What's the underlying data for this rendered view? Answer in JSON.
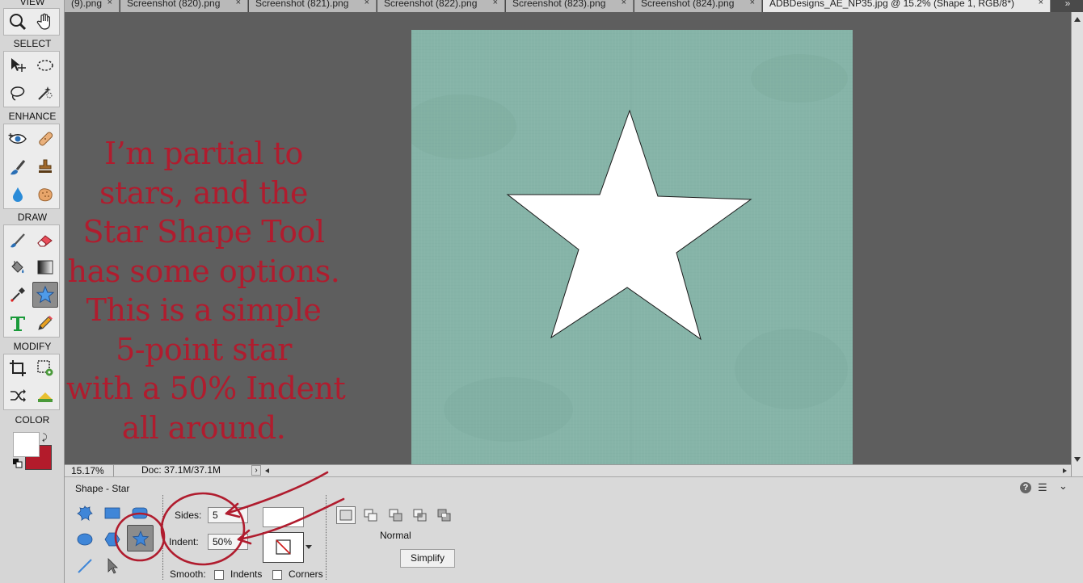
{
  "toolbox": {
    "sections": {
      "view": "VIEW",
      "select": "SELECT",
      "enhance": "ENHANCE",
      "draw": "DRAW",
      "modify": "MODIFY",
      "color": "COLOR"
    },
    "icons": {
      "view": [
        "zoom-icon",
        "hand-icon"
      ],
      "select": [
        "move-icon",
        "marquee-icon",
        "lasso-icon",
        "quick-selection-icon"
      ],
      "enhance": [
        "red-eye-icon",
        "healing-brush-icon",
        "smart-brush-icon",
        "clone-stamp-icon",
        "blur-icon",
        "sponge-icon"
      ],
      "draw": [
        "brush-icon",
        "eraser-icon",
        "paint-bucket-icon",
        "gradient-icon",
        "eyedropper-icon",
        "custom-shape-star-icon",
        "type-icon",
        "pencil-icon"
      ],
      "modify": [
        "crop-icon",
        "recompose-icon",
        "content-aware-move-icon",
        "straighten-icon"
      ]
    },
    "active_tool": "custom-shape-star-icon",
    "colors": {
      "foreground": "#ffffff",
      "background": "#b31b2b"
    }
  },
  "tabs": [
    {
      "label": "(9).png"
    },
    {
      "label": "Screenshot (820).png"
    },
    {
      "label": "Screenshot (821).png"
    },
    {
      "label": "Screenshot (822).png"
    },
    {
      "label": "Screenshot (823).png"
    },
    {
      "label": "Screenshot (824).png"
    },
    {
      "label": "ADBDesigns_AE_NP35.jpg @ 15.2% (Shape 1, RGB/8*)",
      "active": true
    }
  ],
  "tab_close": "×",
  "caption_lines": [
    "I’m partial to",
    "stars, and the",
    "Star Shape Tool",
    "has some options.",
    "This is a simple",
    "5-point star",
    "with a 50% Indent",
    "all around."
  ],
  "status": {
    "zoom": "15.17%",
    "doc_info": "Doc: 37.1M/37.1M"
  },
  "options": {
    "title": "Shape - Star",
    "sides_label": "Sides:",
    "sides_value": "5",
    "indent_label": "Indent:",
    "indent_value": "50%",
    "smooth_label": "Smooth:",
    "indents_label": "Indents",
    "corners_label": "Corners",
    "mode_label": "Normal",
    "simplify_label": "Simplify",
    "fill_color": "#ffffff",
    "shape_icons": [
      "custom-shape-icon",
      "rectangle-icon",
      "rounded-rectangle-icon",
      "ellipse-icon",
      "polygon-icon",
      "star-icon",
      "line-icon",
      "shape-selection-icon"
    ],
    "mode_icons": [
      "new-shape-icon",
      "add-icon",
      "subtract-icon",
      "intersect-icon",
      "exclude-icon"
    ]
  },
  "accent_red": "#b01c2e",
  "paper_color": "#86b4a8"
}
